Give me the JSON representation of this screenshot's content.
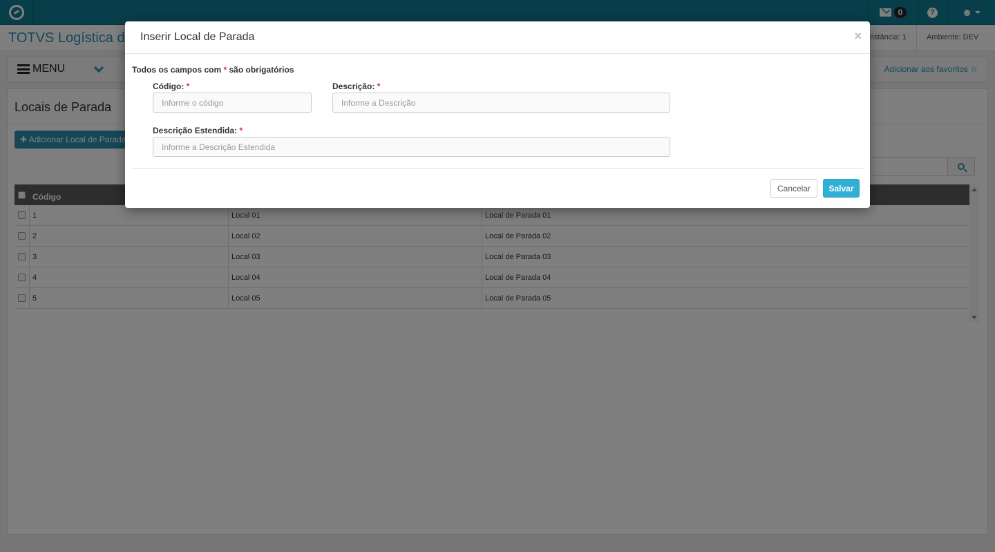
{
  "topbar": {
    "mail_badge": "0",
    "icons": [
      "logo-icon",
      "mail-icon",
      "help-icon",
      "user-icon"
    ],
    "colors": {
      "topbar": "#0e7c93",
      "accent": "#2a8fb3",
      "save": "#31b0d5"
    }
  },
  "header": {
    "app_title": "TOTVS Logística de",
    "instance": "nstância: 1",
    "environment": "Ambiente: DEV"
  },
  "menubar": {
    "menu_label": "MENU",
    "favorites_label": "Adicionar aos favoritos ☆"
  },
  "page": {
    "title": "Locais de Parada",
    "add_button": "Adicionar Local de Parada"
  },
  "table": {
    "headers": [
      "Código",
      "",
      ""
    ],
    "rows": [
      {
        "code": "1",
        "local": "Local 01",
        "description": "Local de Parada 01"
      },
      {
        "code": "2",
        "local": "Local 02",
        "description": "Local de Parada 02"
      },
      {
        "code": "3",
        "local": "Local 03",
        "description": "Local de Parada 03"
      },
      {
        "code": "4",
        "local": "Local 04",
        "description": "Local de Parada 04"
      },
      {
        "code": "5",
        "local": "Local 05",
        "description": "Local de Parada 05"
      }
    ]
  },
  "modal": {
    "title": "Inserir Local de Parada",
    "close": "×",
    "required_note_prefix": "Todos os campos com",
    "required_star": "*",
    "required_note_suffix": "são obrigatórios",
    "codigo_label": "Código:",
    "codigo_placeholder": "Informe o código",
    "descricao_label": "Descrição:",
    "descricao_placeholder": "Informe a Descrição",
    "desc_estendida_label": "Descrição Estendida:",
    "desc_estendida_placeholder": "Informe a Descrição Estendida",
    "cancel_label": "Cancelar",
    "save_label": "Salvar"
  }
}
